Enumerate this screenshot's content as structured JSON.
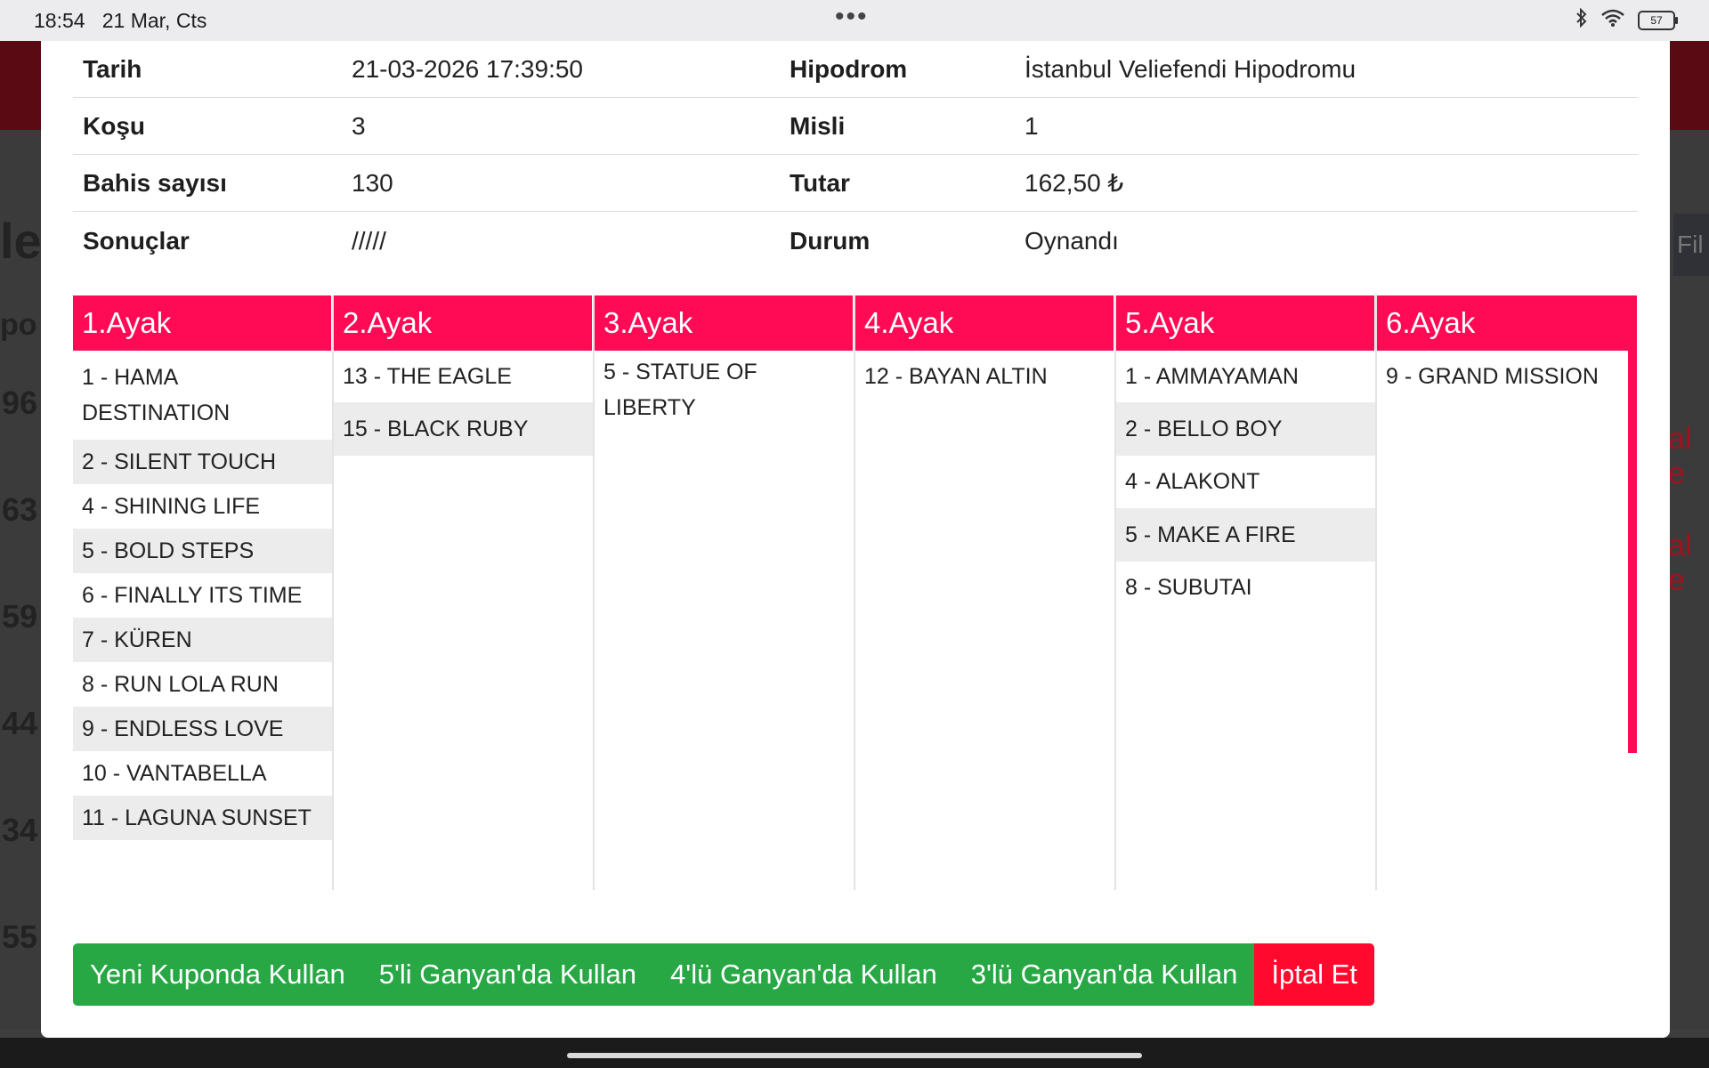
{
  "status_bar": {
    "time": "18:54",
    "date": "21 Mar, Cts",
    "dots": "•••",
    "battery": "57"
  },
  "background": {
    "frag_title": "le",
    "frag_col": "po",
    "frag_rows": [
      "96",
      "63",
      "59",
      "44",
      "34",
      "55"
    ],
    "frag_red": [
      "al e",
      "al e"
    ],
    "filter_text": "Fil"
  },
  "info": {
    "rows": [
      {
        "label1": "Tarih",
        "value1": "21-03-2026 17:39:50",
        "label2": "Hipodrom",
        "value2": "İstanbul Veliefendi Hipodromu"
      },
      {
        "label1": "Koşu",
        "value1": "3",
        "label2": "Misli",
        "value2": "1"
      },
      {
        "label1": "Bahis sayısı",
        "value1": "130",
        "label2": "Tutar",
        "value2": "162,50 ₺"
      },
      {
        "label1": "Sonuçlar",
        "value1": "/////",
        "label2": "Durum",
        "value2": "Oynandı"
      }
    ]
  },
  "legs": [
    {
      "title": "1.Ayak",
      "horses": [
        "1 - HAMA DESTINATION",
        "2 - SILENT TOUCH",
        "4 - SHINING LIFE",
        "5 - BOLD STEPS",
        "6 - FINALLY ITS TIME",
        "7 - KÜREN",
        "8 - RUN LOLA RUN",
        "9 - ENDLESS LOVE",
        "10 - VANTABELLA",
        "11 - LAGUNA SUNSET"
      ]
    },
    {
      "title": "2.Ayak",
      "horses": [
        "13 - THE EAGLE",
        "15 - BLACK RUBY"
      ]
    },
    {
      "title": "3.Ayak",
      "horses": [
        "5 - STATUE OF LIBERTY"
      ]
    },
    {
      "title": "4.Ayak",
      "horses": [
        "12 - BAYAN ALTIN"
      ]
    },
    {
      "title": "5.Ayak",
      "horses": [
        "1 - AMMAYAMAN",
        "2 - BELLO BOY",
        "4 - ALAKONT",
        "5 - MAKE A FIRE",
        "8 - SUBUTAI"
      ]
    },
    {
      "title": "6.Ayak",
      "horses": [
        "9 - GRAND MISSION"
      ]
    }
  ],
  "actions": {
    "new_coupon": "Yeni Kuponda Kullan",
    "ganyan5": "5'li Ganyan'da Kullan",
    "ganyan4": "4'lü Ganyan'da Kullan",
    "ganyan3": "3'lü Ganyan'da Kullan",
    "cancel": "İptal Et"
  },
  "colors": {
    "leg_header": "#ff0a54",
    "action_green": "#28a745",
    "cancel_red": "#ff0a2e"
  }
}
